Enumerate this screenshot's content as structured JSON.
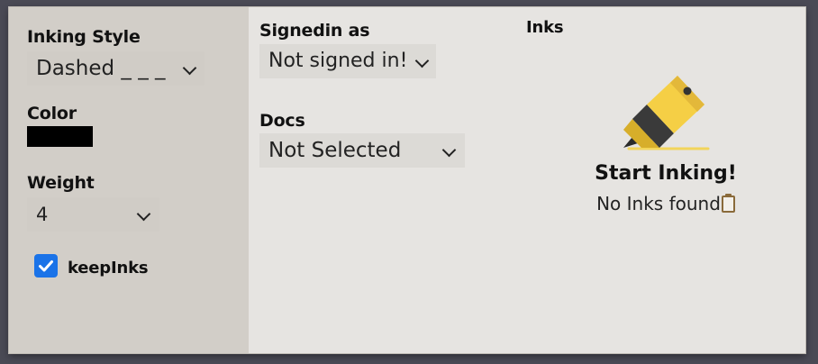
{
  "sidebar": {
    "inking_style_label": "Inking Style",
    "inking_style_value": "Dashed _ _ _",
    "color_label": "Color",
    "color_value": "#000000",
    "weight_label": "Weight",
    "weight_value": "4",
    "keep_inks_label": "keepInks",
    "keep_inks_checked": true
  },
  "signin": {
    "label": "Signedin as",
    "value": "Not signed in!"
  },
  "docs": {
    "label": "Docs",
    "value": "Not Selected"
  },
  "inks": {
    "label": "Inks",
    "empty_title": "Start Inking!",
    "empty_message": "No Inks found",
    "empty_icon": "clipboard-icon",
    "illustration_icon": "highlighter-icon"
  },
  "colors": {
    "sidebar_bg": "#d2cec8",
    "main_bg": "#e6e4e1",
    "checkbox_accent": "#1a73e8",
    "highlighter_yellow": "#f5cf45"
  }
}
